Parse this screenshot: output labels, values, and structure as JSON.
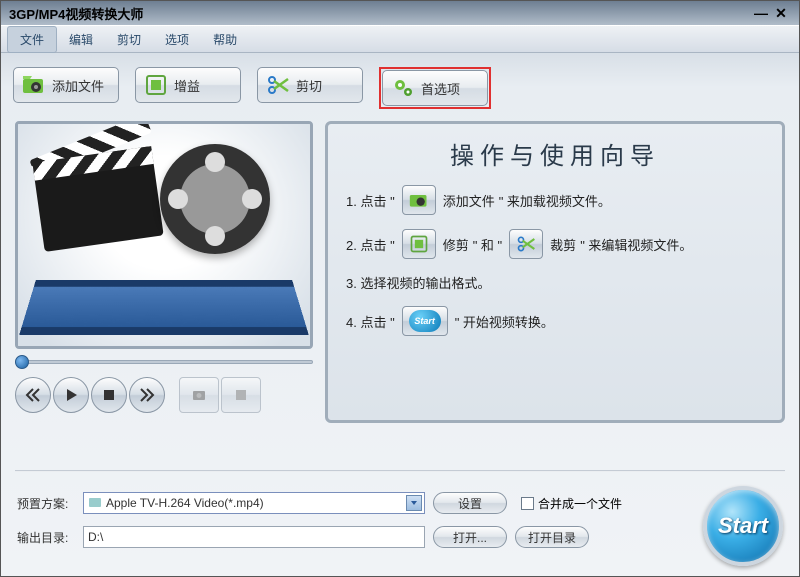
{
  "title": "3GP/MP4视频转换大师",
  "menu": {
    "file": "文件",
    "edit": "编辑",
    "cut": "剪切",
    "options": "选项",
    "help": "帮助"
  },
  "toolbar": {
    "add": "添加文件",
    "gain": "增益",
    "cut": "剪切",
    "pref": "首选项"
  },
  "guide": {
    "heading": "操作与使用向导",
    "step1_a": "1.  点击 \"",
    "step1_b": "添加文件",
    "step1_c": "\" 来加载视频文件。",
    "step2_a": "2.  点击 \"",
    "step2_trim": "修剪",
    "step2_and": "\"  和  \"",
    "step2_crop": "裁剪",
    "step2_c": "\" 来编辑视频文件。",
    "step3": "3.  选择视频的输出格式。",
    "step4_a": "4.  点击 \"",
    "step4_b": "\" 开始视频转换。",
    "start_mini": "Start"
  },
  "profile": {
    "label": "预置方案:",
    "value": "Apple TV-H.264 Video(*.mp4)",
    "settings": "设置",
    "merge": "合并成一个文件"
  },
  "output": {
    "label": "输出目录:",
    "value": "D:\\",
    "open": "打开...",
    "open_dir": "打开目录"
  },
  "start_big": "Start"
}
